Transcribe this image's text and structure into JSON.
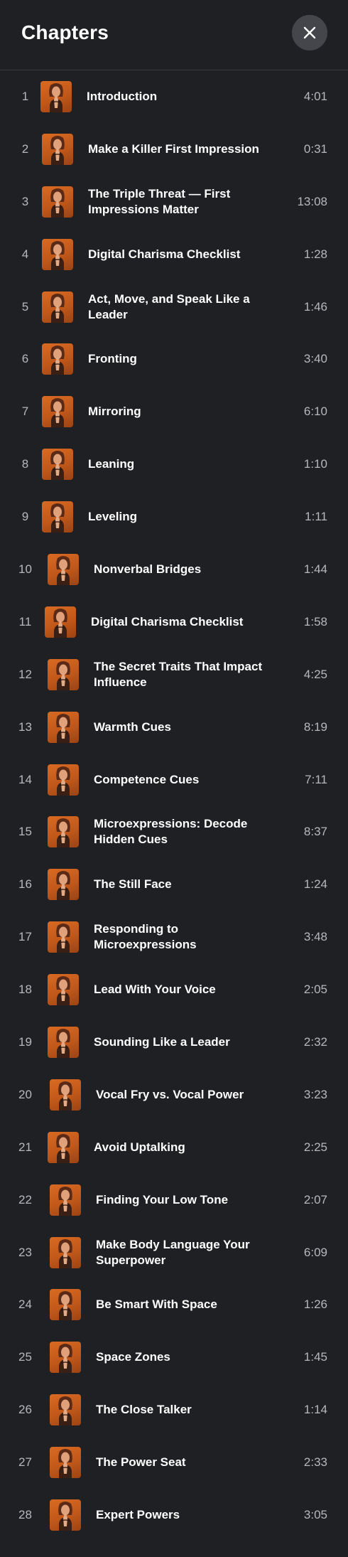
{
  "header": {
    "title": "Chapters",
    "close_icon": "close-icon"
  },
  "chapters": [
    {
      "num": "1",
      "title": "Introduction",
      "duration": "4:01"
    },
    {
      "num": "2",
      "title": "Make a Killer First Impression",
      "duration": "0:31"
    },
    {
      "num": "3",
      "title": "The Triple Threat — First Impressions Matter",
      "duration": "13:08"
    },
    {
      "num": "4",
      "title": "Digital Charisma Checklist",
      "duration": "1:28"
    },
    {
      "num": "5",
      "title": "Act, Move, and Speak Like a Leader",
      "duration": "1:46"
    },
    {
      "num": "6",
      "title": "Fronting",
      "duration": "3:40"
    },
    {
      "num": "7",
      "title": "Mirroring",
      "duration": "6:10"
    },
    {
      "num": "8",
      "title": "Leaning",
      "duration": "1:10"
    },
    {
      "num": "9",
      "title": "Leveling",
      "duration": "1:11"
    },
    {
      "num": "10",
      "title": "Nonverbal Bridges",
      "duration": "1:44"
    },
    {
      "num": "11",
      "title": "Digital Charisma Checklist",
      "duration": "1:58"
    },
    {
      "num": "12",
      "title": "The Secret Traits That Impact Influence",
      "duration": "4:25"
    },
    {
      "num": "13",
      "title": "Warmth Cues",
      "duration": "8:19"
    },
    {
      "num": "14",
      "title": "Competence Cues",
      "duration": "7:11"
    },
    {
      "num": "15",
      "title": "Microexpressions: Decode Hidden Cues",
      "duration": "8:37"
    },
    {
      "num": "16",
      "title": "The Still Face",
      "duration": "1:24"
    },
    {
      "num": "17",
      "title": "Responding to Microexpressions",
      "duration": "3:48"
    },
    {
      "num": "18",
      "title": "Lead With Your Voice",
      "duration": "2:05"
    },
    {
      "num": "19",
      "title": "Sounding Like a Leader",
      "duration": "2:32"
    },
    {
      "num": "20",
      "title": "Vocal Fry vs. Vocal Power",
      "duration": "3:23"
    },
    {
      "num": "21",
      "title": "Avoid Uptalking",
      "duration": "2:25"
    },
    {
      "num": "22",
      "title": "Finding Your Low Tone",
      "duration": "2:07"
    },
    {
      "num": "23",
      "title": "Make Body Language Your Superpower",
      "duration": "6:09"
    },
    {
      "num": "24",
      "title": "Be Smart With Space",
      "duration": "1:26"
    },
    {
      "num": "25",
      "title": "Space Zones",
      "duration": "1:45"
    },
    {
      "num": "26",
      "title": "The Close Talker",
      "duration": "1:14"
    },
    {
      "num": "27",
      "title": "The Power Seat",
      "duration": "2:33"
    },
    {
      "num": "28",
      "title": "Expert Powers",
      "duration": "3:05"
    }
  ],
  "colors": {
    "background": "#1f2024",
    "close_button_bg": "#45464c",
    "thumbnail_orange": "#d96a22",
    "muted_text": "#b7b8bd"
  }
}
